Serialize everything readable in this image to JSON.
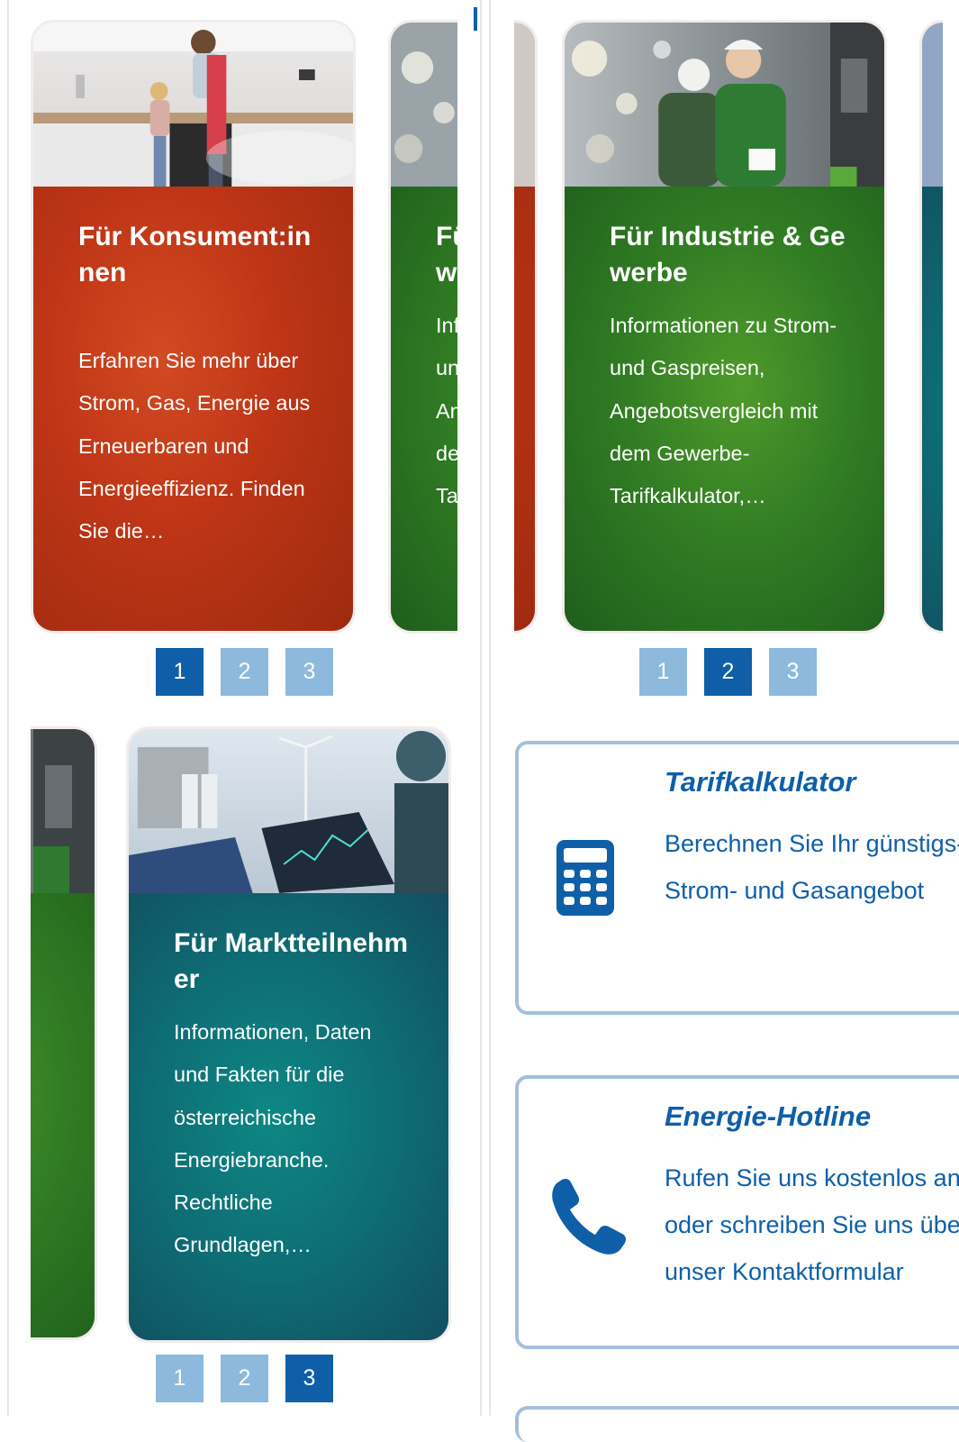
{
  "carousels": [
    {
      "active_card": {
        "title": "Für Konsument:innen",
        "text": "Erfahren Sie mehr über Strom, Gas, Energie aus Erneuerbaren und Energieeffizienz. Finden Sie die…",
        "image": "kitchen-photo"
      },
      "peek_card": {
        "title": "Für Industrie & Gewerbe",
        "text": "Informationen zu Strom- und Gaspreisen, Angebotsvergleich mit dem Gewerbe-Tarifkalkulator,…"
      },
      "pages": [
        "1",
        "2",
        "3"
      ],
      "active_page": 1
    },
    {
      "active_card": {
        "title": "Für Industrie & Gewerbe",
        "text": "Informationen zu Strom- und Gaspreisen, Angebotsvergleich mit dem Gewerbe-Tarifkalkulator,…",
        "image": "industry-workers-photo"
      },
      "pages": [
        "1",
        "2",
        "3"
      ],
      "active_page": 2
    },
    {
      "active_card": {
        "title": "Für Marktteilnehmer",
        "text": "Informationen, Daten und Fakten für die österreichische Energiebranche. Rechtliche Grundlagen,…",
        "image": "energy-market-photo"
      },
      "pages": [
        "1",
        "2",
        "3"
      ],
      "active_page": 3
    }
  ],
  "services": [
    {
      "title": "Tarifkalkulator",
      "text": "Berechnen Sie Ihr günstigs-tes Strom- und Gasangebot",
      "icon": "calculator-icon"
    },
    {
      "title": "Energie-Hotline",
      "text": "Rufen Sie uns kostenlos an oder schreiben Sie uns über unser Kontaktformular",
      "icon": "phone-icon"
    }
  ],
  "colors": {
    "red": "#bd3516",
    "green": "#327d24",
    "teal": "#0e6d74",
    "brand_blue": "#0e5fa8",
    "pager_inactive": "#8db9dc"
  }
}
